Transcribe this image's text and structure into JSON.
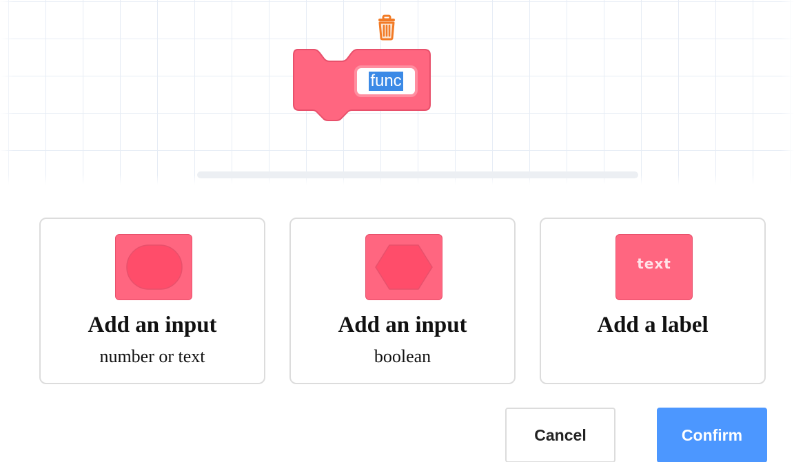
{
  "workspace": {
    "block": {
      "name_value": "func",
      "color": "#ff6680"
    },
    "trash_icon": "trash-icon"
  },
  "options": [
    {
      "title": "Add an input",
      "subtitle": "number or text",
      "icon": "round-input-icon"
    },
    {
      "title": "Add an input",
      "subtitle": "boolean",
      "icon": "boolean-input-icon"
    },
    {
      "title": "Add a label",
      "subtitle": "",
      "icon": "label-icon",
      "icon_text": "text"
    }
  ],
  "buttons": {
    "cancel_label": "Cancel",
    "confirm_label": "Confirm"
  },
  "colors": {
    "block_pink": "#ff6680",
    "confirm_blue": "#4c97ff",
    "trash_orange": "#f27b26"
  }
}
